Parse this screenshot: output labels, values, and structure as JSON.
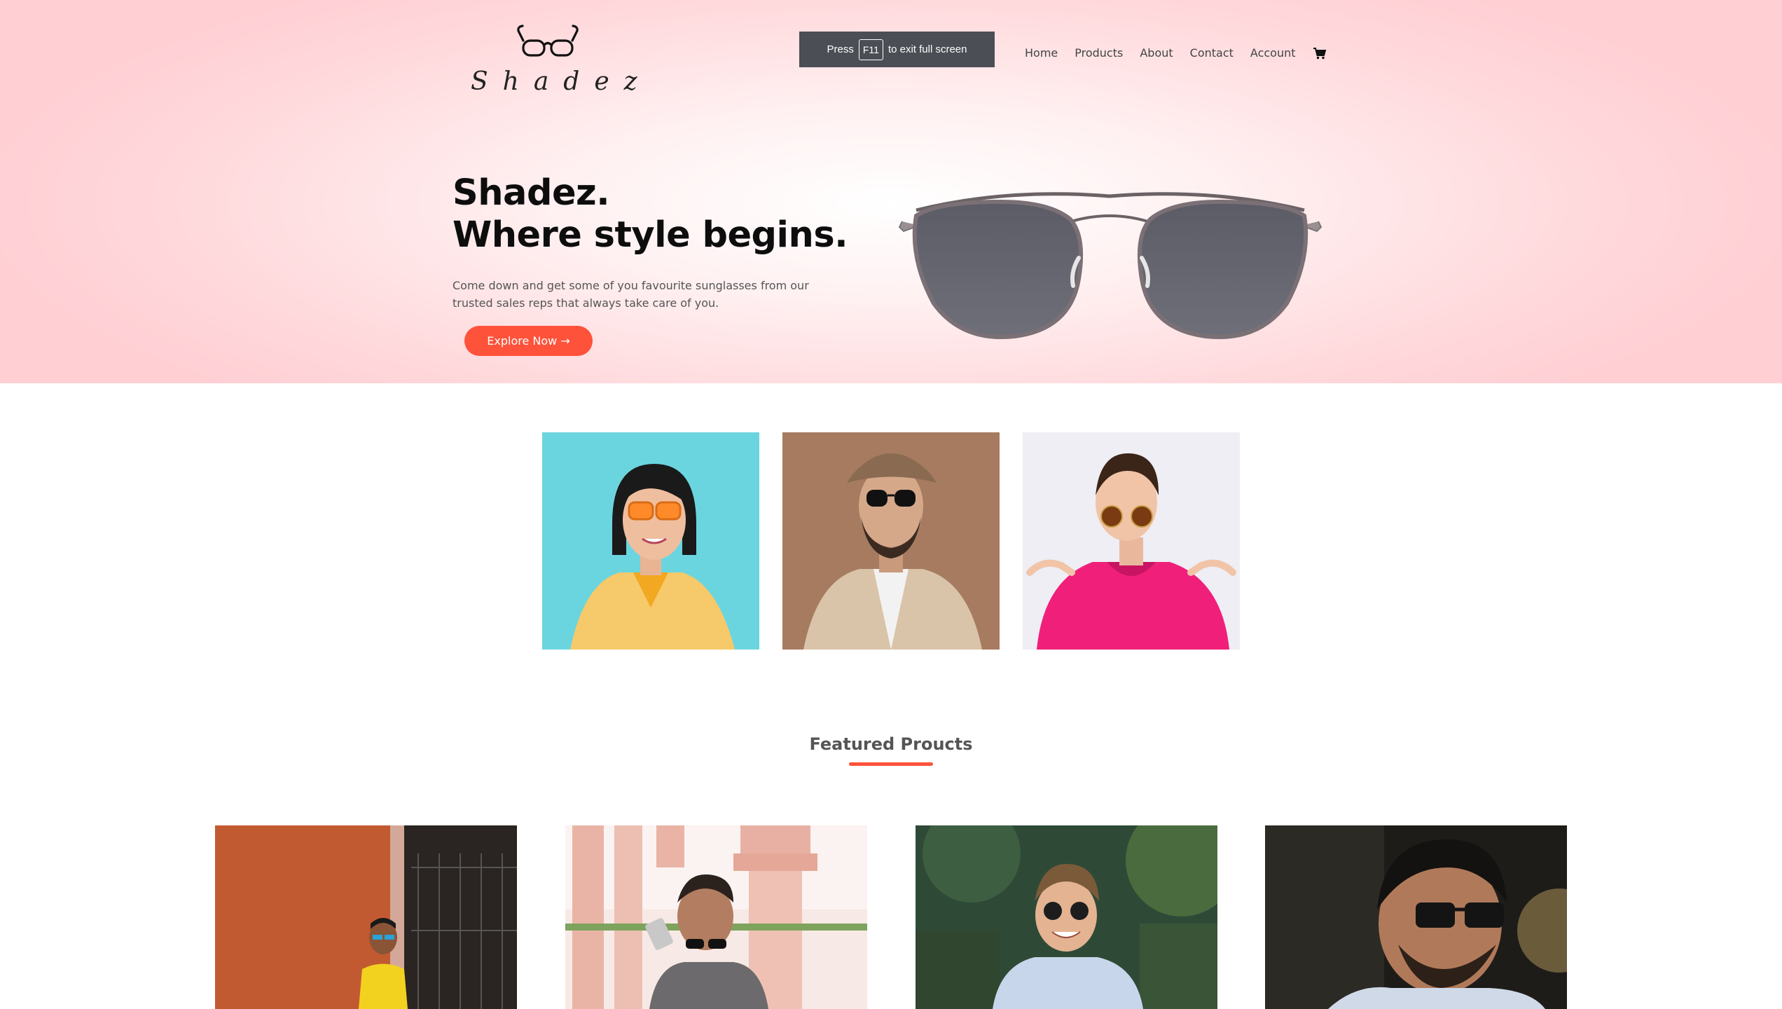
{
  "brand": {
    "name": "Shadez"
  },
  "fullscreen_notice": {
    "prefix": "Press",
    "key": "F11",
    "suffix": "to exit full screen"
  },
  "nav": {
    "items": [
      "Home",
      "Products",
      "About",
      "Contact",
      "Account"
    ],
    "cart_icon": "cart-icon"
  },
  "hero": {
    "title_line1": "Shadez.",
    "title_line2": "Where style begins.",
    "description": "Come down and get some of you favourite sunglasses from our trusted sales reps that always take care of you.",
    "cta_label": "Explore Now →",
    "accent_color": "#ff523b"
  },
  "categories": [
    {
      "name": "woman-orange-sunglasses-photo"
    },
    {
      "name": "man-cap-sunglasses-photo"
    },
    {
      "name": "woman-pink-jacket-sunglasses-photo"
    }
  ],
  "featured": {
    "title": "Featured Proucts",
    "products": [
      {
        "name": "product-photo-yellow-shirt"
      },
      {
        "name": "product-photo-pillars"
      },
      {
        "name": "product-photo-smiling-man"
      },
      {
        "name": "product-photo-man-closeup"
      }
    ]
  }
}
